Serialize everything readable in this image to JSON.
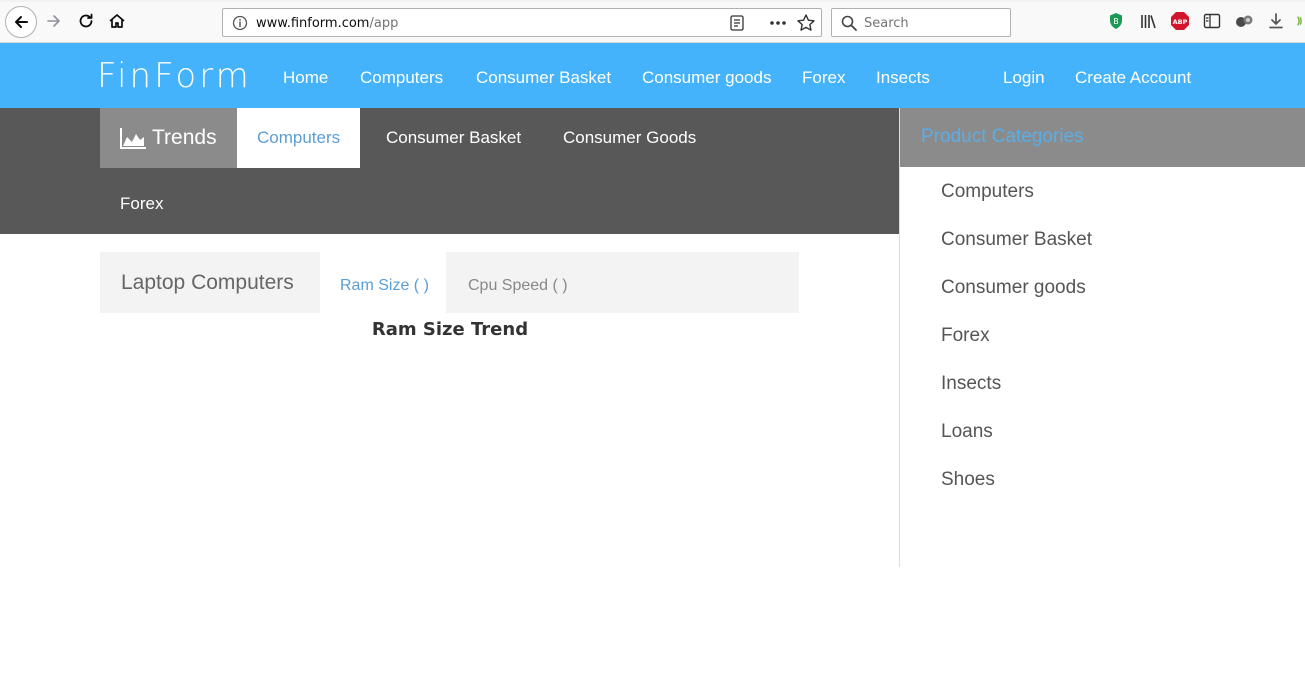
{
  "browser": {
    "url_host": "www.finform.com",
    "url_path": "/app",
    "search_placeholder": "Search",
    "icons": [
      "back-icon",
      "forward-icon",
      "reload-icon",
      "home-icon",
      "info-icon",
      "reader-icon",
      "more-icon",
      "star-icon",
      "search-icon",
      "shield-icon",
      "library-icon",
      "adblock-icon",
      "sidebar-icon",
      "extension-icon",
      "download-icon"
    ]
  },
  "site": {
    "brand": "FinForm",
    "nav": [
      "Home",
      "Computers",
      "Consumer Basket",
      "Consumer goods",
      "Forex",
      "Insects"
    ],
    "login": "Login",
    "create_account": "Create Account"
  },
  "trends": {
    "label": "Trends",
    "tabs": [
      "Computers",
      "Consumer Basket",
      "Consumer Goods",
      "Forex"
    ],
    "active_tab": "Computers"
  },
  "content": {
    "section": "Laptop Computers",
    "subtabs": [
      "Ram Size ( )",
      "Cpu Speed ( )"
    ],
    "active_subtab": "Ram Size ( )",
    "chart_title": "Ram Size Trend"
  },
  "sidebar": {
    "title": "Product Categories",
    "items": [
      "Computers",
      "Consumer Basket",
      "Consumer goods",
      "Forex",
      "Insects",
      "Loans",
      "Shoes"
    ]
  },
  "colors": {
    "nav_bg": "#44b3fb",
    "trends_bg": "#585858",
    "tab_gray": "#8b8b8b",
    "accent_blue": "#5a9ed6"
  }
}
